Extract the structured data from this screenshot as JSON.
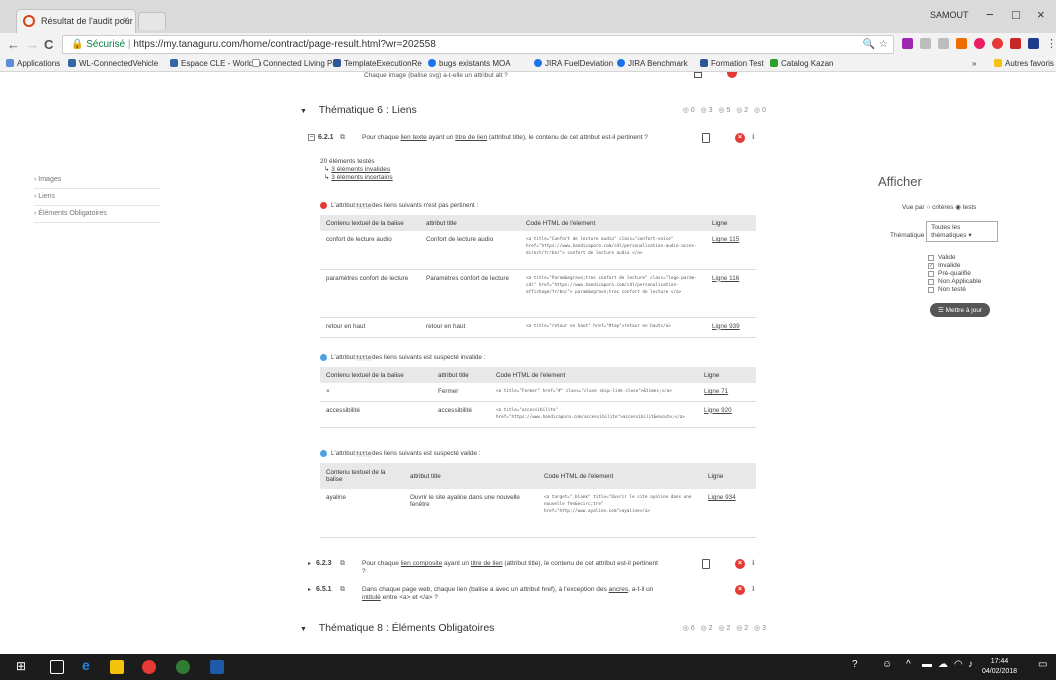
{
  "browser": {
    "tab_title": "Résultat de l'audit pour l",
    "tab_close": "×",
    "profile_name": "SAMOUT",
    "window_controls": [
      "−",
      "□",
      "×"
    ],
    "nav": {
      "back": "←",
      "forward": "→",
      "reload": "C"
    },
    "address": {
      "secure_label": "Sécurisé",
      "separator": "|",
      "url": "https://my.tanaguru.com/home/contract/page-result.html?wr=202558"
    },
    "bookmarks": [
      {
        "label": "Applications",
        "color": "#5a8fd8"
      },
      {
        "label": "WL-ConnectedVehicle",
        "color": "#3465a4"
      },
      {
        "label": "Espace CLE - Worldlin",
        "color": "#3465a4"
      },
      {
        "label": "Connected Living Por",
        "color": "#999999"
      },
      {
        "label": "TemplateExecutionRe",
        "color": "#2b5797"
      },
      {
        "label": "bugs existants MOA",
        "color": "#1a73e8"
      },
      {
        "label": "JIRA FuelDeviation",
        "color": "#1a73e8"
      },
      {
        "label": "JIRA Benchmark",
        "color": "#2b5797"
      },
      {
        "label": "Formation Test",
        "color": "#2b5797"
      },
      {
        "label": "Catalog Kazan",
        "color": "#2ca02c"
      }
    ],
    "bookmarks_more": "»",
    "other_bookmarks": "Autres favoris"
  },
  "leftnav": {
    "items": [
      "› Images",
      "› Liens",
      "› Éléments Obligatoires"
    ]
  },
  "top_cut_text": "Chaque image (balise svg) a-t-elle un attribut alt ?",
  "theme6": {
    "title": "Thématique 6 : Liens",
    "counts": [
      "0",
      "3",
      "5",
      "2",
      "0"
    ],
    "criterion": {
      "num": "6.2.1",
      "text_pre": "Pour chaque ",
      "link1": "lien texte",
      "text_mid": " ayant un ",
      "link2": "titre de lien",
      "text_post": " (attribut title), le contenu de cet attribut est-il pertinent ?"
    },
    "summary": {
      "tested": "20 éléments testés",
      "invalid": "3 éléments invalides",
      "uncertain": "3 éléments incertains"
    },
    "table1": {
      "note_pre": "L'attribut ",
      "note_code": "title",
      "note_post": " des liens suivants n'est pas pertinent :",
      "headers": [
        "Contenu textuel de la balise",
        "attribut title",
        "Code HTML de l'element",
        "Ligne"
      ],
      "rows": [
        {
          "text": "confort de lecture audio",
          "attr": "Confort de lecture audio",
          "code": "<a title=\"Confort de lecture audio\" class=\"confort-voice\" href=\"https://www.handicaporo.com/cdl/personalisation-audio-acces-direct/fr/bn/\"> confort de lecture audio </a>",
          "line": "Ligne 115"
        },
        {
          "text": "paramètres confort de lecture",
          "attr": "Paramètres confort de lecture",
          "code": "<a title=\"Param&egrave;tres confort de lecture\" class=\"logo-param-cdl\" href=\"https://www.handicaporo.com/cdl/personalisation-affichage/fr/bn/\"> param&egrave;tres confort de lecture </a>",
          "line": "Ligne 116"
        },
        {
          "text": "retour en haut",
          "attr": "retour en haut",
          "code": "<a title=\"retour en haut\" href=\"#top\">retour en haut</a>",
          "line": "Ligne 939"
        }
      ]
    },
    "table2": {
      "note_pre": "L'attribut ",
      "note_code": "title",
      "note_post": " des liens suivants est suspecté invalide :",
      "headers": [
        "Contenu textuel de la balise",
        "attribut title",
        "Code HTML de l'element",
        "Ligne"
      ],
      "rows": [
        {
          "text": "×",
          "attr": "Fermer",
          "code": "<a title=\"Fermer\" href=\"#\" class=\"close skip-link-close\">&times;</a>",
          "line": "Ligne 71"
        },
        {
          "text": "accessibilité",
          "attr": "accessibilité",
          "code": "<a title=\"accessibilite\" href=\"https://www.handicaporo.com/accessibilite\">accessibilit&eacute;</a>",
          "line": "Ligne 920"
        }
      ]
    },
    "table3": {
      "note_pre": "L'attribut ",
      "note_code": "title",
      "note_post": " des liens suivants est suspecté valide :",
      "headers": [
        "Contenu textuel de la balise",
        "attribut title",
        "Code HTML de l'element",
        "Ligne"
      ],
      "rows": [
        {
          "text": "ayaline",
          "attr": "Ouvrir le site ayaline dans une nouvelle fenêtre",
          "code": "<a target=\"_blank\" title=\"Ouvrir le site ayaline dans une nouvelle fen&ecirc;tre\" href=\"http://www.ayaline.com\">ayaline</a>",
          "line": "Ligne 934"
        }
      ]
    },
    "crit623": {
      "num": "6.2.3",
      "text_pre": "Pour chaque ",
      "link1": "lien composite",
      "text_mid": " ayant un ",
      "link2": "titre de lien",
      "text_post": " (attribut title), le contenu de cet attribut est-il pertinent ?"
    },
    "crit651": {
      "num": "6.5.1",
      "text_pre": "Dans chaque page web, chaque lien (balise a avec un attribut href), à l'exception des ",
      "link1": "ancres",
      "text_mid": ", a-t-il un ",
      "link2": "intitulé",
      "text_post": " entre <a> et </a> ?"
    }
  },
  "theme8": {
    "title": "Thématique 8 : Éléments Obligatoires",
    "counts": [
      "6",
      "2",
      "2",
      "2",
      "3"
    ]
  },
  "right_panel": {
    "title": "Afficher",
    "vue_label": "Vue par",
    "vue_options": [
      "critères",
      "tests"
    ],
    "theme_label": "Thématique",
    "theme_select": "Toutes les thématiques",
    "filters": [
      {
        "label": "Valide",
        "checked": false
      },
      {
        "label": "Invalide",
        "checked": true
      },
      {
        "label": "Pré-qualifié",
        "checked": false
      },
      {
        "label": "Non Applicable",
        "checked": false
      },
      {
        "label": "Non testé",
        "checked": false
      }
    ],
    "update_button": "Mettre à jour"
  },
  "taskbar": {
    "time": "17:44",
    "date": "04/02/2018"
  },
  "colors": {
    "error": "#e53935",
    "uncertain_blue": "#4aa3df",
    "accent": "#d84315"
  }
}
